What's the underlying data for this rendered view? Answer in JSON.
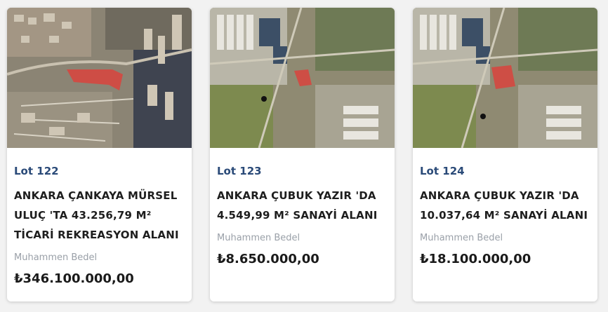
{
  "lots": [
    {
      "lot": "Lot 122",
      "title": "ANKARA ÇANKAYA MÜRSEL ULUÇ 'TA 43.256,79 M² TİCARİ REKREASYON ALANI",
      "price_label": "Muhammen Bedel",
      "price": "₺346.100.000,00",
      "image": "satellite-map-urban-parcel"
    },
    {
      "lot": "Lot 123",
      "title": "ANKARA ÇUBUK YAZIR 'DA 4.549,99 M² SANAYİ ALANI",
      "price_label": "Muhammen Bedel",
      "price": "₺8.650.000,00",
      "image": "satellite-map-industrial-parcel"
    },
    {
      "lot": "Lot 124",
      "title": "ANKARA ÇUBUK YAZIR 'DA 10.037,64 M² SANAYİ ALANI",
      "price_label": "Muhammen Bedel",
      "price": "₺18.100.000,00",
      "image": "satellite-map-industrial-parcel"
    }
  ]
}
